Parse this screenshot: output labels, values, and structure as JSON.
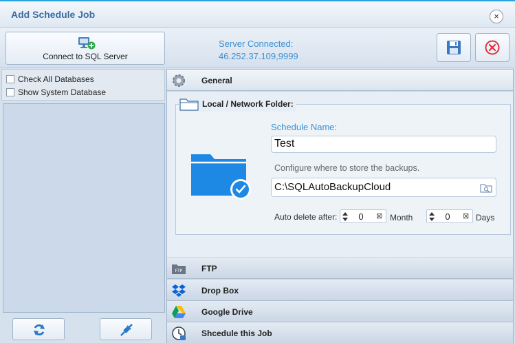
{
  "window": {
    "title": "Add Schedule Job",
    "close_glyph": "×"
  },
  "toolbar": {
    "connect_label": "Connect to SQL Server",
    "server_status_line1": "Server Connected:",
    "server_status_line2": "46.252.37.109,9999"
  },
  "left": {
    "check_all_label": "Check All Databases",
    "show_system_label": "Show System Database"
  },
  "sections": {
    "general": "General",
    "ftp": "FTP",
    "dropbox": "Drop Box",
    "gdrive": "Google Drive",
    "schedule": "Shcedule this Job"
  },
  "general": {
    "group_title": "Local / Network Folder:",
    "schedule_name_label": "Schedule Name:",
    "schedule_name_value": "Test",
    "configure_label": "Configure where to store the backups.",
    "path_value": "C:\\SQLAutoBackupCloud",
    "auto_delete_label": "Auto delete after:",
    "month_value": "0",
    "month_label": "Month",
    "days_value": "0",
    "days_label": "Days",
    "ftp_icon_text": "FTP"
  },
  "colors": {
    "accent": "#3d8fd0",
    "folder": "#1e88e5",
    "cancel": "#e0303a"
  }
}
